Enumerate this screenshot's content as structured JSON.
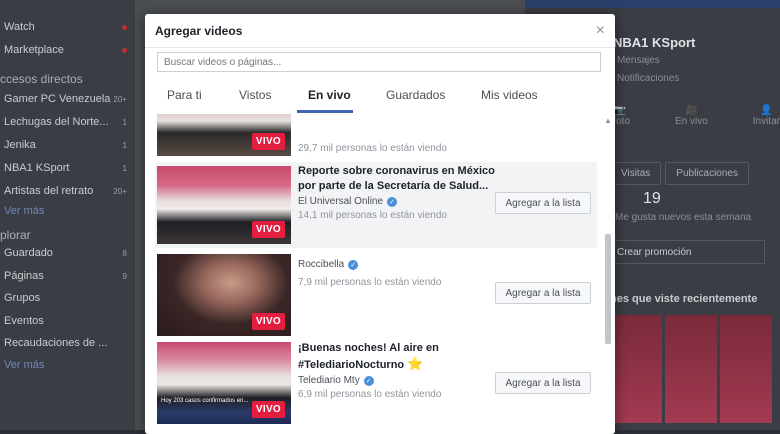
{
  "background": {
    "left_nav": {
      "items_top": [
        {
          "label": "Watch",
          "badge": "dot"
        },
        {
          "label": "Marketplace",
          "badge": "dot"
        }
      ],
      "section_shortcuts": "ccesos directos",
      "shortcuts": [
        {
          "label": "Gamer PC Venezuela",
          "count": "20+"
        },
        {
          "label": "Lechugas del Norte...",
          "count": "1"
        },
        {
          "label": "Jenika",
          "count": "1"
        },
        {
          "label": "NBA1 KSport",
          "count": "1"
        },
        {
          "label": "Artistas del retrato",
          "count": "20+"
        }
      ],
      "more_1": "Ver más",
      "section_explore": "plorar",
      "explore": [
        {
          "label": "Guardado",
          "count": "8"
        },
        {
          "label": "Páginas",
          "count": "9"
        },
        {
          "label": "Grupos",
          "count": ""
        },
        {
          "label": "Eventos",
          "count": ""
        },
        {
          "label": "Recaudaciones de ...",
          "count": ""
        }
      ],
      "more_2": "Ver más"
    },
    "right": {
      "page_name": "NBA1 KSport",
      "messages": "Mensajes",
      "notifications": "Notificaciones",
      "actions": [
        "Foto",
        "En vivo",
        "Invitar"
      ],
      "tabs": [
        "Visitas",
        "Publicaciones"
      ],
      "stat_value": "19",
      "stat_label": "Me gusta nuevos esta semana",
      "promo": "Crear promoción",
      "recent": "nes que viste recientemente"
    }
  },
  "modal": {
    "title": "Agregar videos",
    "close": "×",
    "search_placeholder": "Buscar videos o páginas...",
    "tabs": [
      "Para ti",
      "Vistos",
      "En vivo",
      "Guardados",
      "Mis videos"
    ],
    "active_tab": "En vivo",
    "live_badge": "VIVO",
    "add_button": "Agregar a la lista",
    "videos": [
      {
        "title": "",
        "channel": "",
        "viewers": "29,7 mil personas lo están viendo"
      },
      {
        "title": "Reporte sobre coronavirus en México por parte de la Secretaría de Salud...",
        "channel": "El Universal Online",
        "verified": true,
        "viewers": "14,1 mil personas lo están viendo"
      },
      {
        "title": "",
        "channel": "Roccibella",
        "verified": true,
        "viewers": "7,9 mil personas lo están viendo"
      },
      {
        "title": "¡Buenas noches! Al aire en #TelediarioNocturno",
        "channel": "Telediario Mty",
        "verified": true,
        "viewers": "6,9 mil personas lo están viendo"
      }
    ],
    "thumb4_caption": "Hoy 203 casos confirmados en..."
  },
  "colors": {
    "accent": "#4267b2",
    "live_red": "#e41e3f",
    "verified_blue": "#4a90d9"
  }
}
